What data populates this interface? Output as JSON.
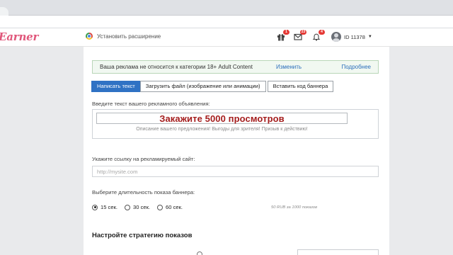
{
  "site": {
    "logo_text": "Earner",
    "brand_color": "#e0567a",
    "extension_label": "Установить расширение",
    "extension_icon": "chrome-icon"
  },
  "header": {
    "gift_badge": "1",
    "mail_badge": "23",
    "bell_badge": "4",
    "user_id": "ID 11378"
  },
  "notice": {
    "text": "Ваша реклама не относится к категории 18+ Adult Content",
    "change_link": "Изменить",
    "more_link": "Подробнее"
  },
  "tabs": [
    {
      "label": "Написать текст",
      "active": true
    },
    {
      "label": "Загрузить файл (изображение или анимации)",
      "active": false
    },
    {
      "label": "Вставить код баннера",
      "active": false
    }
  ],
  "ad_text": {
    "label": "Введите текст вашего рекламного объявления:",
    "title": "Закажите 5000 просмотров",
    "description": "Описание вашего предложения! Выгоды для зрителя! Призыв к действию!"
  },
  "url": {
    "label": "Укажите ссылку на рекламируемый сайт:",
    "placeholder": "http://mysite.com",
    "value": ""
  },
  "duration": {
    "label": "Выберите длительность показа баннера:",
    "options": [
      {
        "label": "15 сек.",
        "selected": true
      },
      {
        "label": "30 сек.",
        "selected": false
      },
      {
        "label": "60 сек.",
        "selected": false
      }
    ],
    "price_note": "50 RUB за 1000 показов"
  },
  "strategy": {
    "heading": "Настройте стратегию показов"
  },
  "colors": {
    "accent": "#2f72c4",
    "ad_title": "#a41c1c",
    "notice_bg": "#f1f8f1",
    "badge": "#e53935"
  }
}
